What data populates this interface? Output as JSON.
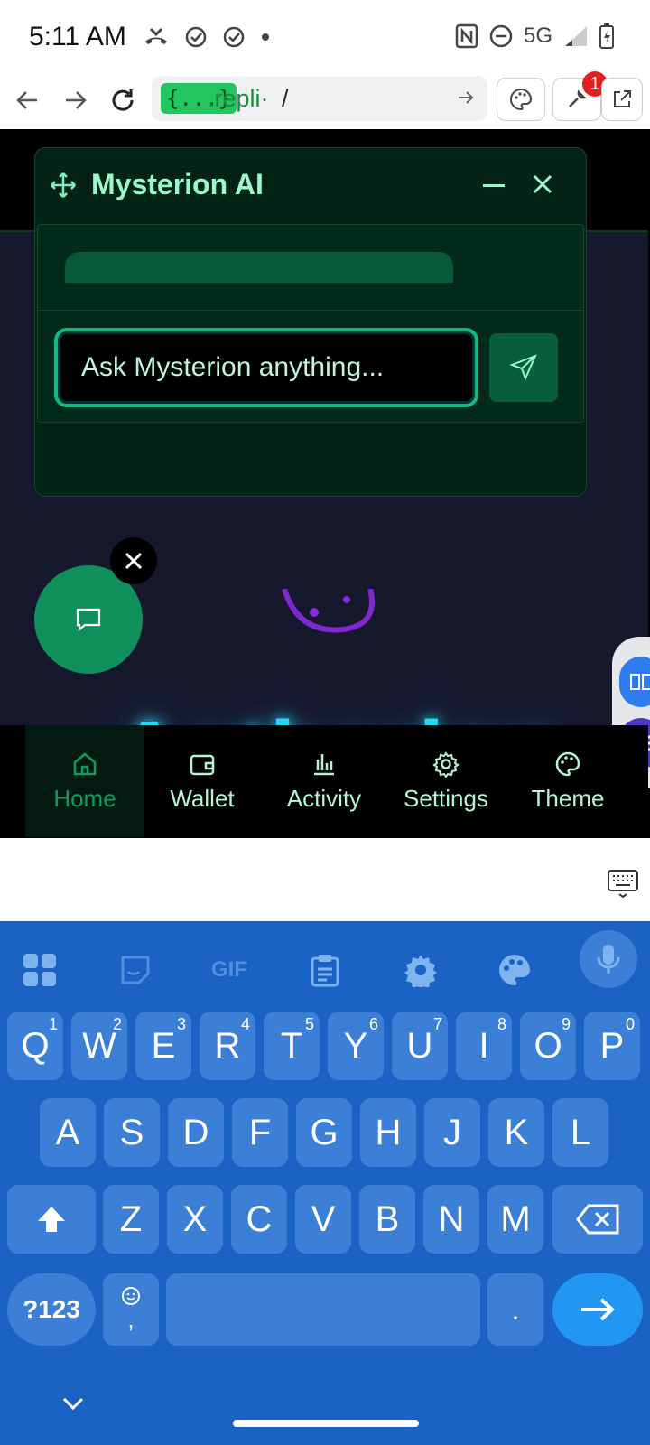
{
  "status": {
    "time": "5:11 AM",
    "network": "5G"
  },
  "browser": {
    "url_badge": "{...}",
    "url_domain": ".repli·",
    "url_path": "/",
    "notification_count": "1"
  },
  "ai_panel": {
    "title": "Mysterion AI",
    "input_placeholder": "Ask Mysterion anything..."
  },
  "hero": {
    "title": "Aetherion"
  },
  "nav": {
    "items": [
      {
        "label": "Home",
        "icon": "home-icon"
      },
      {
        "label": "Wallet",
        "icon": "wallet-icon"
      },
      {
        "label": "Activity",
        "icon": "bar-chart-icon"
      },
      {
        "label": "Settings",
        "icon": "gear-icon"
      },
      {
        "label": "Theme",
        "icon": "palette-icon"
      }
    ]
  },
  "keyboard": {
    "tool_gif": "GIF",
    "row1": [
      "Q",
      "W",
      "E",
      "R",
      "T",
      "Y",
      "U",
      "I",
      "O",
      "P"
    ],
    "row1_hints": [
      "1",
      "2",
      "3",
      "4",
      "5",
      "6",
      "7",
      "8",
      "9",
      "0"
    ],
    "row2": [
      "A",
      "S",
      "D",
      "F",
      "G",
      "H",
      "J",
      "K",
      "L"
    ],
    "row3": [
      "Z",
      "X",
      "C",
      "V",
      "B",
      "N",
      "M"
    ],
    "sym_key": "?123",
    "comma_key": ",",
    "period_key": "."
  },
  "colors": {
    "accent": "#10b981",
    "hero_title": "#27d7f5",
    "keyboard_bg": "#1a63c4"
  }
}
